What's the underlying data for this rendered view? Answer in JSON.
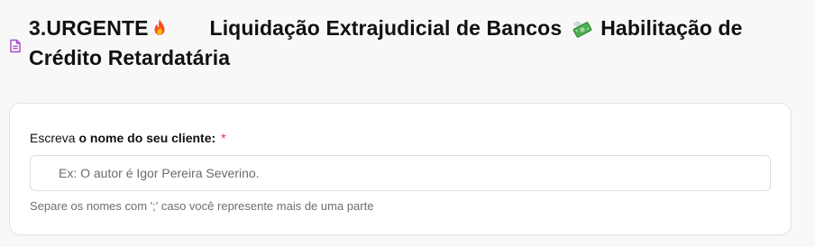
{
  "header": {
    "title_part1": "3.URGENTE",
    "title_part2": "Liquidação Extrajudicial de Bancos",
    "title_part3": "Habilitação de Crédito Retardatária",
    "icons": {
      "leading": "document-icon",
      "first_emoji": "fire-icon",
      "second_emoji": "money-with-wings-icon"
    }
  },
  "form": {
    "label_prefix": "Escreva ",
    "label_bold": "o nome do seu cliente:",
    "required_mark": "*",
    "input_value": "",
    "input_placeholder": "Ex: O autor é Igor Pereira Severino.",
    "help_text": "Separe os nomes com ';' caso você represente mais de uma parte"
  },
  "colors": {
    "background": "#f8f8f8",
    "card": "#ffffff",
    "required": "#e0332d",
    "document_icon": "#a64ac9"
  }
}
